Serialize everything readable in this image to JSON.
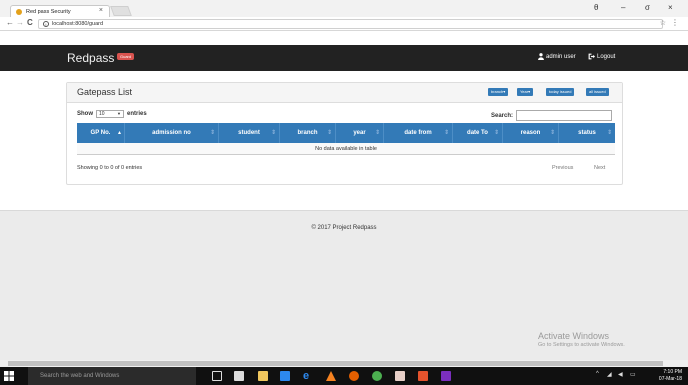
{
  "browser": {
    "tab_title": "Red pass Security",
    "tab_close": "×",
    "url": "localhost:8080/guard",
    "nav_back": "←",
    "nav_forward": "→",
    "nav_reload": "C",
    "star": "☆",
    "menu": "⋮",
    "win_profile": "θ",
    "win_min": "–",
    "win_max": "σ",
    "win_close": "×"
  },
  "app": {
    "brand": "Redpass",
    "brand_badge": "Guard",
    "user": "admin user",
    "logout": "Logout"
  },
  "panel": {
    "title": "Gatepass List",
    "buttons": [
      "branch▾",
      "Year▾",
      "today issued",
      "all issued"
    ]
  },
  "table": {
    "show_label": "Show",
    "length_value": "10",
    "entries_label": "entries",
    "search_label": "Search:",
    "columns": [
      "GP No.",
      "admission no",
      "student",
      "branch",
      "year",
      "date from",
      "date To",
      "reason",
      "status"
    ],
    "empty_message": "No data available in table",
    "info": "Showing 0 to 0 of 0 entries",
    "prev": "Previous",
    "next": "Next"
  },
  "footer": {
    "copyright": "© 2017 Project Redpass"
  },
  "watermark": {
    "title": "Activate Windows",
    "subtitle": "Go to Settings to activate Windows."
  },
  "taskbar": {
    "search_placeholder": "Search the web and Windows",
    "time": "7:10 PM",
    "date": "07-Mar-18"
  },
  "colors": {
    "primary": "#337ab7",
    "navbar": "#222222",
    "badge": "#d9534f"
  }
}
